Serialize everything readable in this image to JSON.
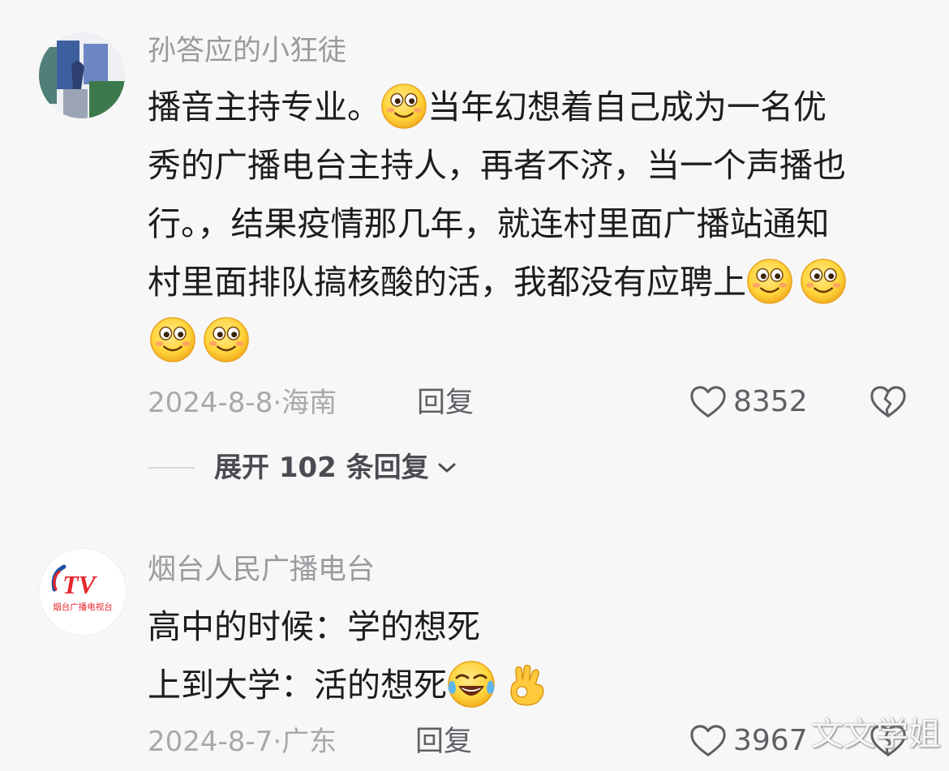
{
  "comments": [
    {
      "username": "孙答应的小狂徒",
      "lines": [
        {
          "before": "播音主持专业。",
          "after": "当年幻想着自己成为一名优"
        },
        {
          "text": "秀的广播电台主持人，再者不济，当一个声播也"
        },
        {
          "text": "行。，结果疫情那几年，就连村里面广播站通知"
        },
        {
          "text": "村里面排队搞核酸的活，我都没有应聘上"
        }
      ],
      "date": "2024-8-8",
      "separator": "·",
      "location": "海南",
      "reply_label": "回复",
      "likes": "8352",
      "emojis": [
        "smile-emoji",
        "smile-emoji",
        "smile-emoji",
        "smile-emoji",
        "smile-emoji"
      ]
    },
    {
      "username": "烟台人民广播电台",
      "avatar_logo_text": "TV",
      "avatar_caption": "烟台广播电视台",
      "lines": [
        {
          "text": "高中的时候：学的想死"
        },
        {
          "text": "上到大学：活的想死"
        }
      ],
      "date": "2024-8-7",
      "separator": "·",
      "location": "广东",
      "reply_label": "回复",
      "likes": "3967",
      "emojis": [
        "laugh-cry-emoji",
        "ok-hand-emoji"
      ]
    }
  ],
  "expand_replies": {
    "label": "展开 102 条回复"
  },
  "watermark": "文文学姐",
  "colors": {
    "background": "#f7f7f7",
    "username": "#9a9a9f",
    "text": "#1d1d1f",
    "meta": "#a8a8ad",
    "emoji_yellow": "#ffd43a",
    "logo_red": "#e8262b",
    "logo_blue": "#1c4fa3"
  }
}
